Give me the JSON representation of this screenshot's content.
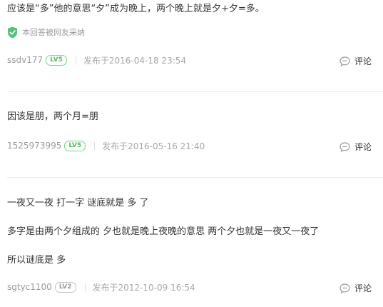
{
  "answers": [
    {
      "lines": [
        "应该是“多”他的意思“夕”成为晚上，两个晚上就是夕+夕=多。"
      ],
      "adopted_label": "本回答被网友采纳",
      "user": "ssdv177",
      "level": "LV5",
      "date": "发布于2016-04-18 23:54",
      "comment_label": "评论"
    },
    {
      "lines": [
        "因该是朋，两个月=朋"
      ],
      "user": "1525973995",
      "level": "LV5",
      "date": "发布于2016-05-16 21:40",
      "comment_label": "评论"
    },
    {
      "lines": [
        "一夜又一夜 打一字 谜底就是 多 了",
        "多字是由两个夕组成的 夕也就是晚上夜晚的意思 两个夕也就是一夜又一夜了",
        "所以谜底是 多"
      ],
      "user": "sgtyc1100",
      "level": "LV2",
      "date": "发布于2012-10-09 16:54",
      "comment_label": "评论"
    }
  ],
  "colors": {
    "adopted_shield": "#52c27a",
    "level_green": "#56b866",
    "level_gray": "#9a9a9a",
    "meta_text": "#9a9a9a",
    "divider": "#ececec"
  },
  "icons": {
    "adopted": "shield-check-icon",
    "comment": "speech-bubble-icon"
  }
}
